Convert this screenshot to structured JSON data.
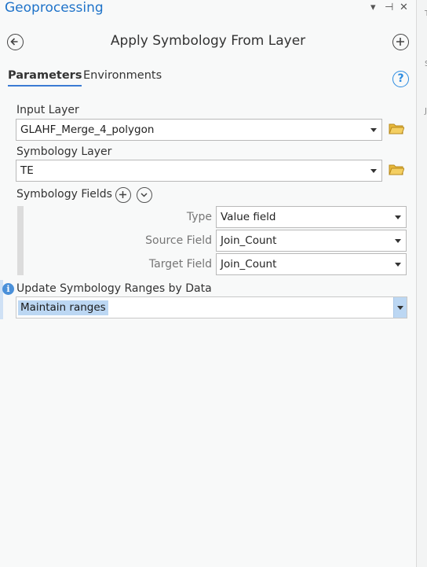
{
  "header": {
    "title": "Geoprocessing",
    "controls": [
      "▾",
      "⊣",
      "✕"
    ]
  },
  "tool": {
    "title": "Apply Symbology From Layer"
  },
  "tabs": [
    {
      "label": "Parameters",
      "active": true
    },
    {
      "label": "Environments",
      "active": false
    }
  ],
  "params": {
    "input_layer": {
      "label": "Input Layer",
      "value": "GLAHF_Merge_4_polygon"
    },
    "symbology_layer": {
      "label": "Symbology Layer",
      "value": "TE"
    },
    "symbology_fields": {
      "label": "Symbology Fields",
      "rows": [
        {
          "label": "Type",
          "value": "Value field"
        },
        {
          "label": "Source Field",
          "value": "Join_Count"
        },
        {
          "label": "Target Field",
          "value": "Join_Count"
        }
      ]
    },
    "update_ranges": {
      "label": "Update Symbology Ranges by Data",
      "value": "Maintain ranges"
    }
  },
  "icons": {
    "back": "back-arrow-icon",
    "add": "add-icon",
    "help": "help-icon",
    "folder": "folder-icon",
    "info": "info-icon"
  },
  "colors": {
    "accent": "#1f73c9",
    "selection": "#bcd7f3",
    "folder": "#e8b83a"
  },
  "right_strip_chars": [
    "T",
    "S",
    "J"
  ]
}
